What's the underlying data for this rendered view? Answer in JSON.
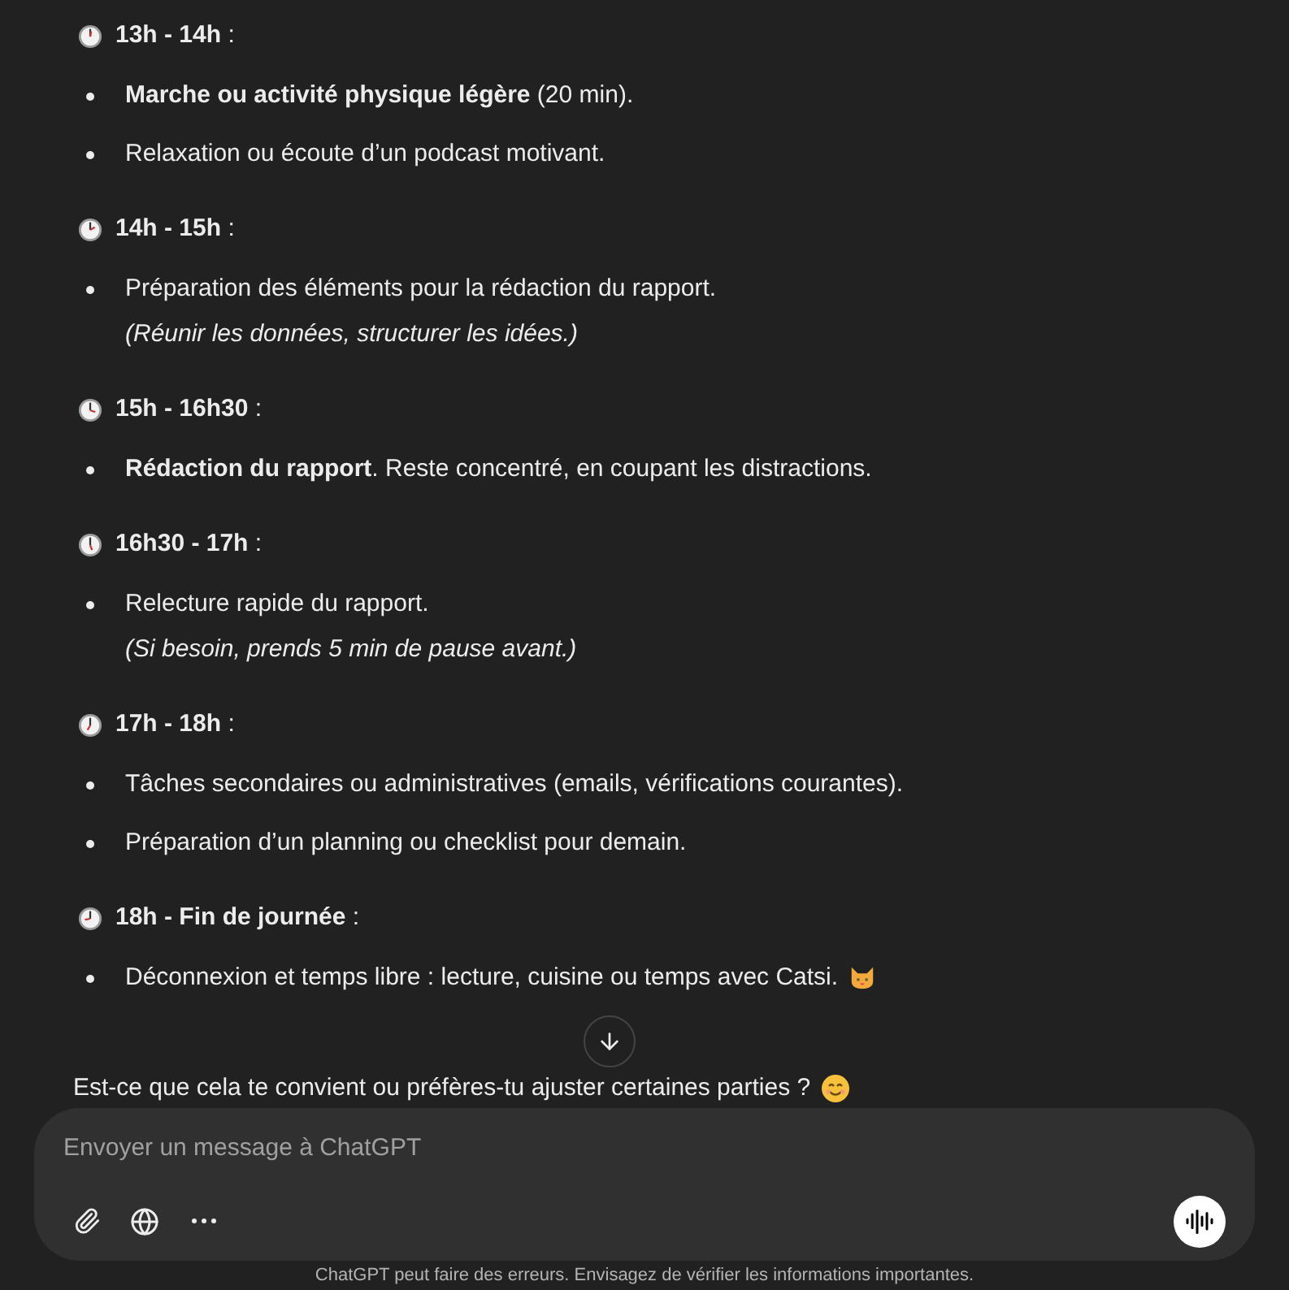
{
  "sections": [
    {
      "time": "**13h - 14h** :",
      "items": [
        {
          "text": "**Marche ou activité physique légère** (20 min)."
        },
        {
          "text": "Relaxation ou écoute d’un podcast motivant."
        }
      ]
    },
    {
      "time": "**14h - 15h** :",
      "items": [
        {
          "text": "Préparation des éléments pour la rédaction du rapport.",
          "note": "(Réunir les données, structurer les idées.)"
        }
      ]
    },
    {
      "time": "**15h - 16h30** :",
      "items": [
        {
          "text": "**Rédaction du rapport**. Reste concentré, en coupant les distractions."
        }
      ]
    },
    {
      "time": "**16h30 - 17h** :",
      "items": [
        {
          "text": "Relecture rapide du rapport.",
          "note": "(Si besoin, prends 5 min de pause avant.)"
        }
      ]
    },
    {
      "time": "**17h - 18h** :",
      "items": [
        {
          "text": "Tâches secondaires ou administratives (emails, vérifications courantes)."
        },
        {
          "text": "Préparation d’un planning ou checklist pour demain."
        }
      ]
    },
    {
      "time": "**18h - Fin de journée** :",
      "items": [
        {
          "text": "Déconnexion et temps libre : lecture, cuisine ou temps avec Catsi."
        }
      ]
    }
  ],
  "closing": {
    "text": "Est-ce que cela te convient ou préfères-tu ajuster certaines parties ?"
  },
  "composer": {
    "placeholder": "Envoyer un message à ChatGPT"
  },
  "disclaimer": "ChatGPT peut faire des erreurs. Envisagez de vérifier les informations importantes."
}
